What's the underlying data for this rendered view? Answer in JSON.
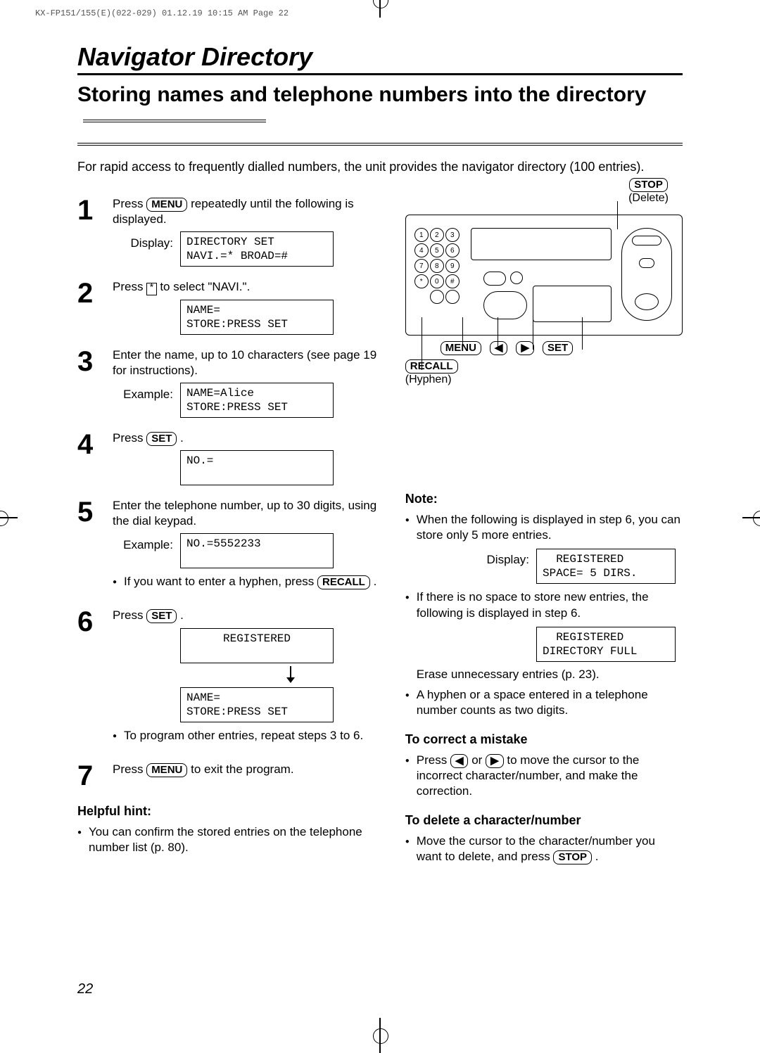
{
  "meta": {
    "header": "KX-FP151/155(E)(022-029)  01.12.19 10:15 AM  Page 22"
  },
  "section": "Navigator Directory",
  "title": "Storing names and telephone numbers into the directory",
  "intro": "For rapid access to frequently dialled numbers, the unit provides the navigator directory (100 entries).",
  "buttons": {
    "menu": "MENU",
    "set": "SET",
    "recall": "RECALL",
    "stop": "STOP",
    "star": "*"
  },
  "steps": {
    "s1": {
      "num": "1",
      "text_a": "Press ",
      "text_b": " repeatedly until the following is displayed.",
      "disp_label": "Display:",
      "lcd": "DIRECTORY SET\nNAVI.=* BROAD=#"
    },
    "s2": {
      "num": "2",
      "text_a": "Press ",
      "text_b": " to select \"NAVI.\".",
      "lcd": "NAME=\nSTORE:PRESS SET"
    },
    "s3": {
      "num": "3",
      "text": "Enter the name, up to 10 characters (see page 19 for instructions).",
      "ex_label": "Example:",
      "lcd": "NAME=Alice\nSTORE:PRESS SET"
    },
    "s4": {
      "num": "4",
      "text_a": "Press ",
      "text_b": ".",
      "lcd": "NO.=\n "
    },
    "s5": {
      "num": "5",
      "text": "Enter the telephone number, up to 30 digits, using the dial keypad.",
      "ex_label": "Example:",
      "lcd": "NO.=5552233\n ",
      "bullet_a": "If you want to enter a hyphen, press ",
      "bullet_b": "."
    },
    "s6": {
      "num": "6",
      "text_a": "Press ",
      "text_b": ".",
      "lcd1": "REGISTERED\n ",
      "lcd2": "NAME=\nSTORE:PRESS SET",
      "bullet": "To program other entries, repeat steps 3 to 6."
    },
    "s7": {
      "num": "7",
      "text_a": "Press ",
      "text_b": " to exit the program."
    }
  },
  "hint": {
    "title": "Helpful hint:",
    "bullet": "You can confirm the stored entries on the telephone number list (p. 80)."
  },
  "annotations": {
    "stop": "STOP",
    "delete": "(Delete)",
    "menu": "MENU",
    "set": "SET",
    "recall": "RECALL",
    "hyphen": "(Hyphen)",
    "left_arrow": "◀",
    "right_arrow": "▶"
  },
  "note": {
    "label": "Note:",
    "b1": "When the following is displayed in step 6, you can store only 5 more entries.",
    "disp_label": "Display:",
    "lcd1": "  REGISTERED\nSPACE= 5 DIRS.",
    "b2": "If there is no space to store new entries, the following is displayed in step 6.",
    "lcd2": "  REGISTERED\nDIRECTORY FULL",
    "erase": "Erase unnecessary entries (p. 23).",
    "b3": "A hyphen or a space entered in a telephone number counts as two digits."
  },
  "correct": {
    "title": "To correct a mistake",
    "b_a": "Press ",
    "b_b": " or ",
    "b_c": " to move the cursor to the incorrect character/number, and make the correction."
  },
  "delete": {
    "title": "To delete a character/number",
    "b_a": "Move the cursor to the character/number you want to delete, and press ",
    "b_b": "."
  },
  "page_number": "22",
  "keypad": [
    "1",
    "2",
    "3",
    "4",
    "5",
    "6",
    "7",
    "8",
    "9",
    "*",
    "0",
    "#",
    " ",
    " ",
    " "
  ]
}
